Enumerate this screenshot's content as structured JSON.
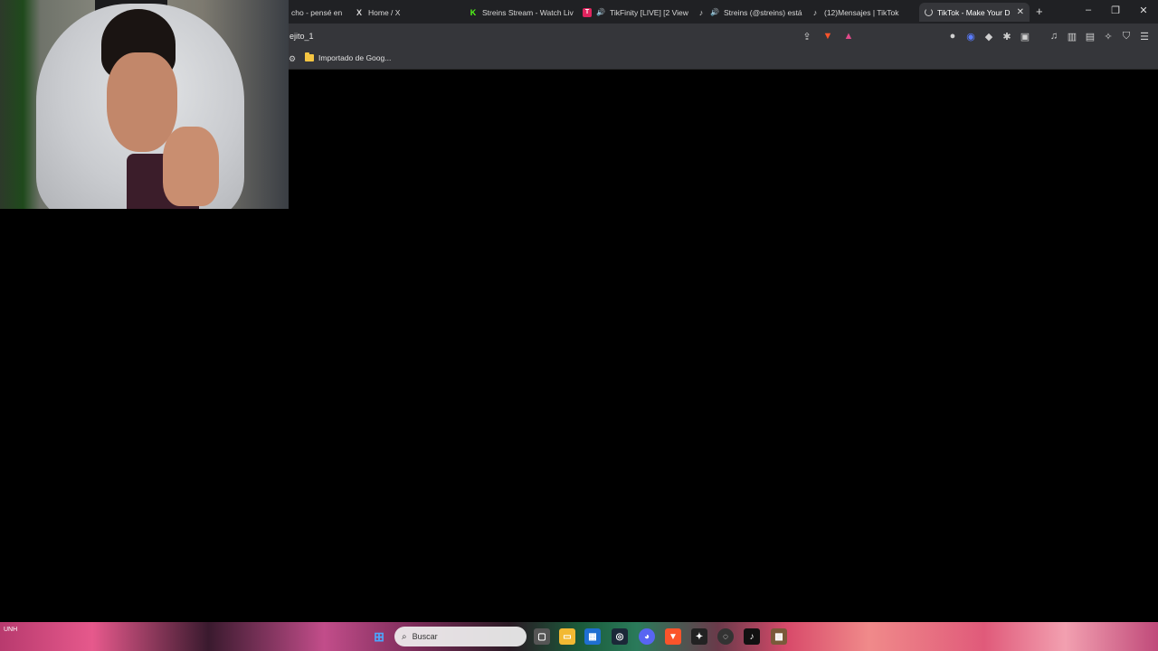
{
  "tabs": [
    {
      "title": "cho - pensé en",
      "favicon": "x-icon-none",
      "active": false
    },
    {
      "title": "Home / X",
      "favicon": "x-logo-icon",
      "active": false
    },
    {
      "title": "Streins Stream - Watch Liv",
      "favicon": "kick-icon",
      "active": false
    },
    {
      "title": "TikFinity [LIVE] [2 View",
      "favicon": "tikfinity-icon",
      "active": false
    },
    {
      "title": "Streins (@streins) está",
      "favicon": "tiktok-icon",
      "active": false
    },
    {
      "title": "(12)Mensajes | TikTok",
      "favicon": "tiktok-icon",
      "active": false
    },
    {
      "title": "TikTok - Make Your D",
      "favicon": "loading-icon",
      "active": true
    }
  ],
  "address_bar": {
    "text": "ejito_1"
  },
  "bookmarks": {
    "folder_label": "Importado de Goog..."
  },
  "taskbar": {
    "search_placeholder": "Buscar",
    "weather_line1": "UNH",
    "weather_line2": ""
  },
  "colors": {
    "tabbar_bg": "#202124",
    "toolbar_bg": "#35363a",
    "page_bg": "#000000"
  }
}
